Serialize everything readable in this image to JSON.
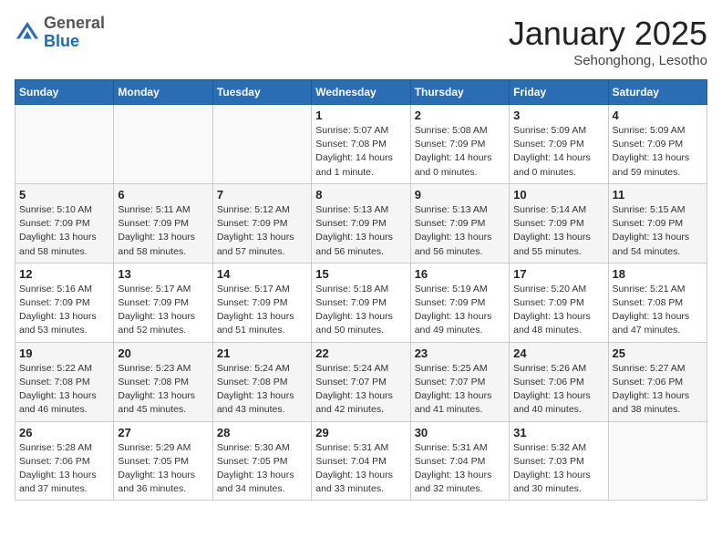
{
  "header": {
    "logo_general": "General",
    "logo_blue": "Blue",
    "month": "January 2025",
    "location": "Sehonghong, Lesotho"
  },
  "weekdays": [
    "Sunday",
    "Monday",
    "Tuesday",
    "Wednesday",
    "Thursday",
    "Friday",
    "Saturday"
  ],
  "weeks": [
    [
      {
        "day": "",
        "info": ""
      },
      {
        "day": "",
        "info": ""
      },
      {
        "day": "",
        "info": ""
      },
      {
        "day": "1",
        "info": "Sunrise: 5:07 AM\nSunset: 7:08 PM\nDaylight: 14 hours\nand 1 minute."
      },
      {
        "day": "2",
        "info": "Sunrise: 5:08 AM\nSunset: 7:09 PM\nDaylight: 14 hours\nand 0 minutes."
      },
      {
        "day": "3",
        "info": "Sunrise: 5:09 AM\nSunset: 7:09 PM\nDaylight: 14 hours\nand 0 minutes."
      },
      {
        "day": "4",
        "info": "Sunrise: 5:09 AM\nSunset: 7:09 PM\nDaylight: 13 hours\nand 59 minutes."
      }
    ],
    [
      {
        "day": "5",
        "info": "Sunrise: 5:10 AM\nSunset: 7:09 PM\nDaylight: 13 hours\nand 58 minutes."
      },
      {
        "day": "6",
        "info": "Sunrise: 5:11 AM\nSunset: 7:09 PM\nDaylight: 13 hours\nand 58 minutes."
      },
      {
        "day": "7",
        "info": "Sunrise: 5:12 AM\nSunset: 7:09 PM\nDaylight: 13 hours\nand 57 minutes."
      },
      {
        "day": "8",
        "info": "Sunrise: 5:13 AM\nSunset: 7:09 PM\nDaylight: 13 hours\nand 56 minutes."
      },
      {
        "day": "9",
        "info": "Sunrise: 5:13 AM\nSunset: 7:09 PM\nDaylight: 13 hours\nand 56 minutes."
      },
      {
        "day": "10",
        "info": "Sunrise: 5:14 AM\nSunset: 7:09 PM\nDaylight: 13 hours\nand 55 minutes."
      },
      {
        "day": "11",
        "info": "Sunrise: 5:15 AM\nSunset: 7:09 PM\nDaylight: 13 hours\nand 54 minutes."
      }
    ],
    [
      {
        "day": "12",
        "info": "Sunrise: 5:16 AM\nSunset: 7:09 PM\nDaylight: 13 hours\nand 53 minutes."
      },
      {
        "day": "13",
        "info": "Sunrise: 5:17 AM\nSunset: 7:09 PM\nDaylight: 13 hours\nand 52 minutes."
      },
      {
        "day": "14",
        "info": "Sunrise: 5:17 AM\nSunset: 7:09 PM\nDaylight: 13 hours\nand 51 minutes."
      },
      {
        "day": "15",
        "info": "Sunrise: 5:18 AM\nSunset: 7:09 PM\nDaylight: 13 hours\nand 50 minutes."
      },
      {
        "day": "16",
        "info": "Sunrise: 5:19 AM\nSunset: 7:09 PM\nDaylight: 13 hours\nand 49 minutes."
      },
      {
        "day": "17",
        "info": "Sunrise: 5:20 AM\nSunset: 7:09 PM\nDaylight: 13 hours\nand 48 minutes."
      },
      {
        "day": "18",
        "info": "Sunrise: 5:21 AM\nSunset: 7:08 PM\nDaylight: 13 hours\nand 47 minutes."
      }
    ],
    [
      {
        "day": "19",
        "info": "Sunrise: 5:22 AM\nSunset: 7:08 PM\nDaylight: 13 hours\nand 46 minutes."
      },
      {
        "day": "20",
        "info": "Sunrise: 5:23 AM\nSunset: 7:08 PM\nDaylight: 13 hours\nand 45 minutes."
      },
      {
        "day": "21",
        "info": "Sunrise: 5:24 AM\nSunset: 7:08 PM\nDaylight: 13 hours\nand 43 minutes."
      },
      {
        "day": "22",
        "info": "Sunrise: 5:24 AM\nSunset: 7:07 PM\nDaylight: 13 hours\nand 42 minutes."
      },
      {
        "day": "23",
        "info": "Sunrise: 5:25 AM\nSunset: 7:07 PM\nDaylight: 13 hours\nand 41 minutes."
      },
      {
        "day": "24",
        "info": "Sunrise: 5:26 AM\nSunset: 7:06 PM\nDaylight: 13 hours\nand 40 minutes."
      },
      {
        "day": "25",
        "info": "Sunrise: 5:27 AM\nSunset: 7:06 PM\nDaylight: 13 hours\nand 38 minutes."
      }
    ],
    [
      {
        "day": "26",
        "info": "Sunrise: 5:28 AM\nSunset: 7:06 PM\nDaylight: 13 hours\nand 37 minutes."
      },
      {
        "day": "27",
        "info": "Sunrise: 5:29 AM\nSunset: 7:05 PM\nDaylight: 13 hours\nand 36 minutes."
      },
      {
        "day": "28",
        "info": "Sunrise: 5:30 AM\nSunset: 7:05 PM\nDaylight: 13 hours\nand 34 minutes."
      },
      {
        "day": "29",
        "info": "Sunrise: 5:31 AM\nSunset: 7:04 PM\nDaylight: 13 hours\nand 33 minutes."
      },
      {
        "day": "30",
        "info": "Sunrise: 5:31 AM\nSunset: 7:04 PM\nDaylight: 13 hours\nand 32 minutes."
      },
      {
        "day": "31",
        "info": "Sunrise: 5:32 AM\nSunset: 7:03 PM\nDaylight: 13 hours\nand 30 minutes."
      },
      {
        "day": "",
        "info": ""
      }
    ]
  ]
}
